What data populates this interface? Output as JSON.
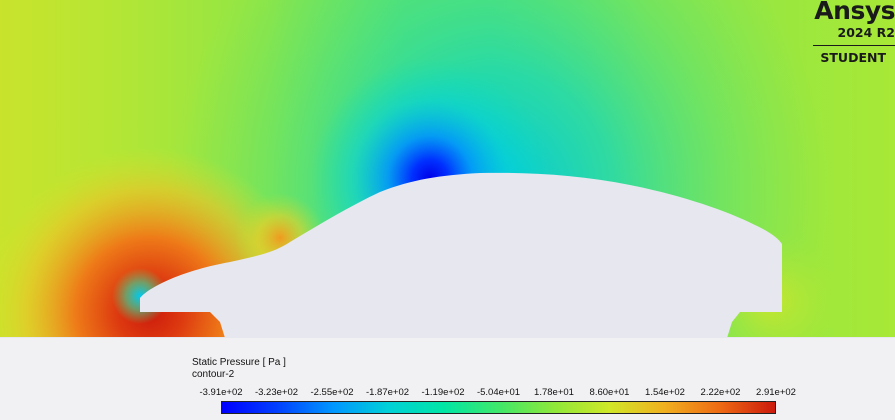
{
  "branding": {
    "product": "Ansys",
    "version": "2024 R2",
    "edition": "STUDENT"
  },
  "legend": {
    "title": "Static Pressure [ Pa ]",
    "subtitle": "contour-2",
    "ticks": [
      "-3.91e+02",
      "-3.23e+02",
      "-2.55e+02",
      "-1.87e+02",
      "-1.19e+02",
      "-5.04e+01",
      "1.78e+01",
      "8.60e+01",
      "1.54e+02",
      "2.22e+02",
      "2.91e+02"
    ],
    "colormap": [
      "#0000ff",
      "#0096ff",
      "#00e6a6",
      "#3fe86a",
      "#d0e828",
      "#ee6a14",
      "#cc1a0c"
    ]
  },
  "colors": {
    "body_fill": "#e6e7ef",
    "ground_fill": "#f1f1f3",
    "freestream": "#a6e838"
  }
}
